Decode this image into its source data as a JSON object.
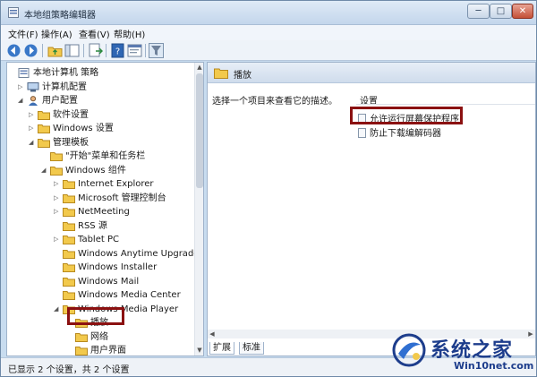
{
  "window": {
    "title": "本地组策略编辑器"
  },
  "menu": [
    "文件(F)",
    "操作(A)",
    "查看(V)",
    "帮助(H)"
  ],
  "toolbar": [
    "back-icon",
    "forward-icon",
    "up-folder-icon",
    "show-hide-tree-icon",
    "export-list-icon",
    "help-icon",
    "properties-icon",
    "filter-icon"
  ],
  "tree": [
    {
      "label": "本地计算机 策略",
      "expander": "",
      "icon": "policy-icon"
    },
    {
      "label": "计算机配置",
      "expander": "▷",
      "icon": "computer-icon"
    },
    {
      "label": "用户配置",
      "expander": "◢",
      "icon": "user-icon"
    },
    {
      "label": "软件设置",
      "expander": "▷",
      "icon": "folder-icon"
    },
    {
      "label": "Windows 设置",
      "expander": "▷",
      "icon": "folder-icon"
    },
    {
      "label": "管理模板",
      "expander": "◢",
      "icon": "folder-icon"
    },
    {
      "label": "\"开始\"菜单和任务栏",
      "expander": "",
      "icon": "folder-icon"
    },
    {
      "label": "Windows 组件",
      "expander": "◢",
      "icon": "folder-icon"
    },
    {
      "label": "Internet Explorer",
      "expander": "▷",
      "icon": "folder-icon"
    },
    {
      "label": "Microsoft 管理控制台",
      "expander": "▷",
      "icon": "folder-icon"
    },
    {
      "label": "NetMeeting",
      "expander": "▷",
      "icon": "folder-icon"
    },
    {
      "label": "RSS 源",
      "expander": "",
      "icon": "folder-icon"
    },
    {
      "label": "Tablet PC",
      "expander": "▷",
      "icon": "folder-icon"
    },
    {
      "label": "Windows Anytime Upgrade",
      "expander": "",
      "icon": "folder-icon"
    },
    {
      "label": "Windows Installer",
      "expander": "",
      "icon": "folder-icon"
    },
    {
      "label": "Windows Mail",
      "expander": "",
      "icon": "folder-icon"
    },
    {
      "label": "Windows Media Center",
      "expander": "",
      "icon": "folder-icon"
    },
    {
      "label": "Windows Media Player",
      "expander": "◢",
      "icon": "folder-icon"
    },
    {
      "label": "播放",
      "expander": "",
      "icon": "folder-icon"
    },
    {
      "label": "网络",
      "expander": "",
      "icon": "folder-icon"
    },
    {
      "label": "用户界面",
      "expander": "",
      "icon": "folder-icon"
    }
  ],
  "right": {
    "header": "播放",
    "description": "选择一个项目来查看它的描述。",
    "column": "设置",
    "settings": [
      "允许运行屏幕保护程序",
      "防止下载编解码器"
    ]
  },
  "tabs": [
    "扩展",
    "标准"
  ],
  "status": "已显示 2 个设置，共 2 个设置",
  "watermark": {
    "cn": "系统之家",
    "en": "Win10net.com"
  },
  "colors": {
    "highlight": "#8b1111",
    "folder": "#f2c94c",
    "watermark": "#1d3d8c"
  }
}
